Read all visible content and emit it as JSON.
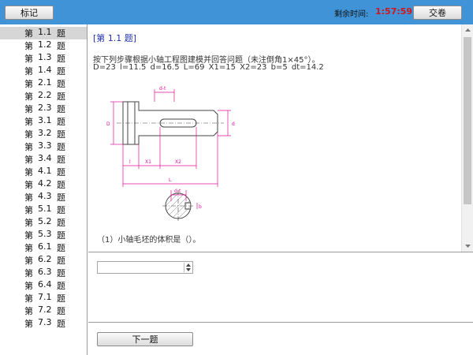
{
  "toolbar": {
    "mark_label": "标记",
    "timer_label": "剩余时间:",
    "timer_value": "1:57:59",
    "submit_label": "交卷"
  },
  "sidebar": {
    "prefix": "第",
    "suffix": "题",
    "items": [
      "1.1",
      "1.2",
      "1.3",
      "1.4",
      "2.1",
      "2.2",
      "2.3",
      "3.1",
      "3.2",
      "3.3",
      "3.4",
      "4.1",
      "4.2",
      "4.3",
      "5.1",
      "5.2",
      "5.3",
      "6.1",
      "6.2",
      "6.3",
      "6.4",
      "7.1",
      "7.2",
      "7.3"
    ],
    "selected_index": 0
  },
  "question": {
    "title": "[第 1.1 题]",
    "line1": "按下列步骤根据小轴工程图建模并回答问题（未注倒角1×45°）。",
    "line2": "D=23   l=11.5   d=16.5   L=69   X1=15   X2=23   b=5   dt=14.2",
    "subquestion": "（1）小轴毛坯的体积是（）。"
  },
  "drawing_labels": {
    "d_t": "d-t",
    "D": "D",
    "d": "d",
    "l": "l",
    "X1": "X1",
    "X2": "X2",
    "L": "L",
    "dt": "d-t",
    "b": "b"
  },
  "answer": {
    "select_value": ""
  },
  "next_label": "下一题",
  "colors": {
    "header": "#3f93d6",
    "timer": "#d4141a",
    "title": "#2233aa",
    "dimension": "#e0109a"
  }
}
